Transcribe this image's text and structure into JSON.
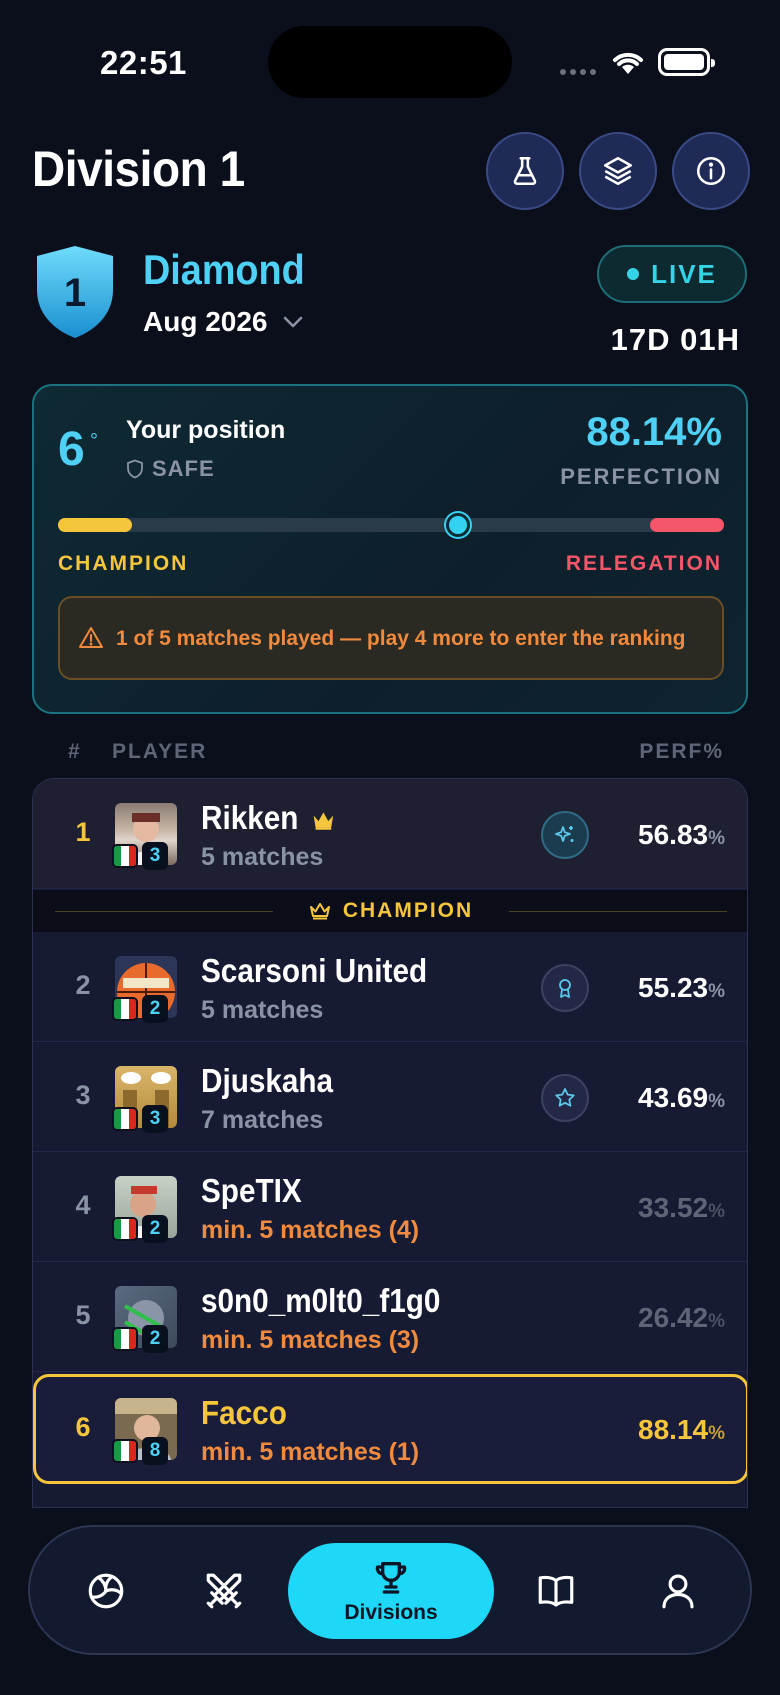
{
  "status_bar": {
    "time": "22:51"
  },
  "header": {
    "title": "Division 1"
  },
  "division": {
    "shield_number": "1",
    "name": "Diamond",
    "month": "Aug 2026",
    "live_label": "LIVE",
    "countdown": "17D 01H"
  },
  "position_card": {
    "rank": "6",
    "rank_suffix": "°",
    "title": "Your position",
    "status": "SAFE",
    "perfection_value": "88.14%",
    "perfection_label": "PERFECTION",
    "progress_fraction": 0.6,
    "champion_label": "CHAMPION",
    "relegation_label": "RELEGATION",
    "warning_text": "1 of 5 matches played — play 4 more to enter the ranking"
  },
  "table": {
    "col_rank": "#",
    "col_player": "PLAYER",
    "col_perf": "PERF%",
    "champion_separator": "CHAMPION",
    "rows": [
      {
        "rank": "1",
        "name": "Rikken",
        "level": "3",
        "meta": "5 matches",
        "perf": "56.83",
        "unit": "%"
      },
      {
        "rank": "2",
        "name": "Scarsoni United",
        "level": "2",
        "meta": "5 matches",
        "perf": "55.23",
        "unit": "%"
      },
      {
        "rank": "3",
        "name": "Djuskaha",
        "level": "3",
        "meta": "7 matches",
        "perf": "43.69",
        "unit": "%"
      },
      {
        "rank": "4",
        "name": "SpeTIX",
        "level": "2",
        "meta": "min. 5 matches (4)",
        "perf": "33.52",
        "unit": "%"
      },
      {
        "rank": "5",
        "name": "s0n0_m0lt0_f1g0",
        "level": "2",
        "meta": "min. 5 matches (3)",
        "perf": "26.42",
        "unit": "%"
      },
      {
        "rank": "6",
        "name": "Facco",
        "level": "8",
        "meta": "min. 5 matches (1)",
        "perf": "88.14",
        "unit": "%"
      }
    ]
  },
  "nav": {
    "active_label": "Divisions",
    "items": [
      "volleyball-icon",
      "swords-icon",
      "trophy-icon",
      "book-icon",
      "user-icon"
    ]
  },
  "colors": {
    "accent": "#1fd7f6",
    "champion": "#f5c63c",
    "relegation": "#f4566a",
    "warning": "#f08a3e",
    "background": "#0a0f1b"
  }
}
